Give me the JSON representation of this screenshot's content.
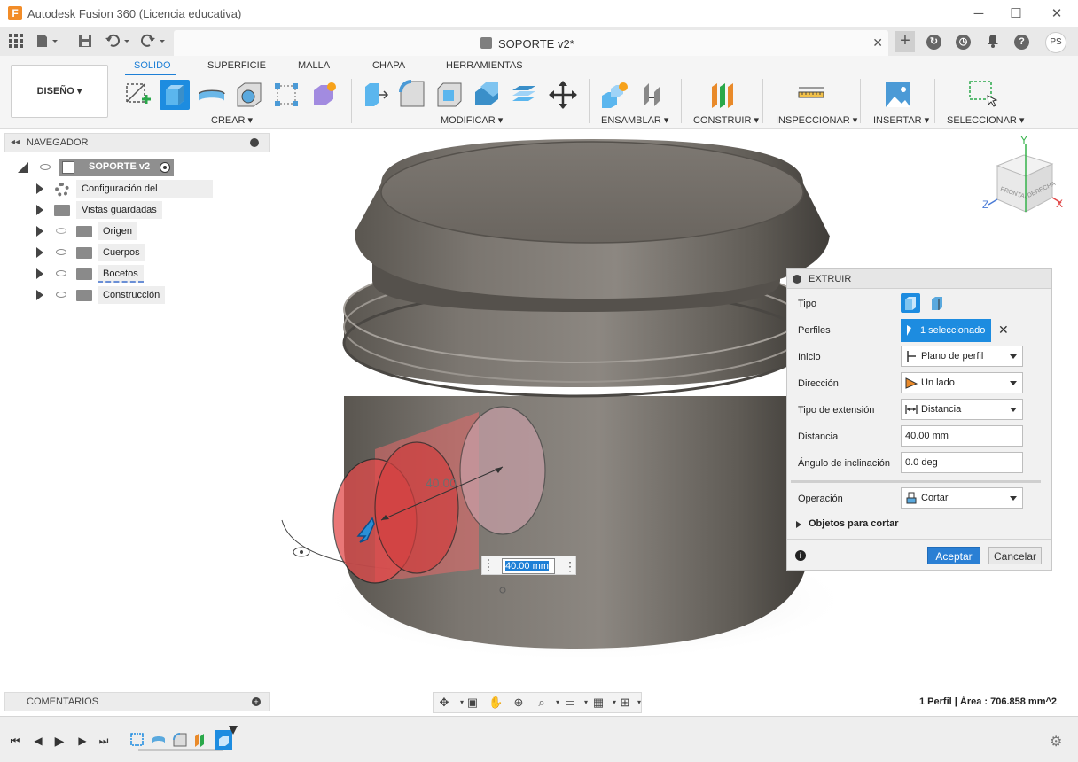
{
  "window": {
    "app_logo": "F",
    "title": "Autodesk Fusion 360 (Licencia educativa)",
    "minimize": "─",
    "maximize": "☐",
    "close": "✕"
  },
  "tabbar": {
    "document_title": "SOPORTE v2*",
    "tab_close": "✕",
    "new_tab": "+",
    "avatar": "PS"
  },
  "ribbon": {
    "workspace": "DISEÑO ▾",
    "tabs": [
      "SOLIDO",
      "SUPERFICIE",
      "MALLA",
      "CHAPA",
      "HERRAMIENTAS"
    ],
    "groups": [
      "CREAR ▾",
      "MODIFICAR ▾",
      "ENSAMBLAR ▾",
      "CONSTRUIR ▾",
      "INSPECCIONAR ▾",
      "INSERTAR ▾",
      "SELECCIONAR ▾"
    ],
    "accent": "#1d8ce0"
  },
  "navigator": {
    "title": "NAVEGADOR",
    "root": "SOPORTE v2",
    "items": [
      {
        "label": "Configuración del documento"
      },
      {
        "label": "Vistas guardadas"
      },
      {
        "label": "Origen"
      },
      {
        "label": "Cuerpos"
      },
      {
        "label": "Bocetos"
      },
      {
        "label": "Construcción"
      }
    ]
  },
  "comments": {
    "title": "COMENTARIOS"
  },
  "extrude_panel": {
    "title": "EXTRUIR",
    "rows": {
      "tipo": "Tipo",
      "perfiles": "Perfiles",
      "perfiles_value": "1 seleccionado",
      "inicio": "Inicio",
      "inicio_value": "Plano de perfil",
      "direccion": "Dirección",
      "direccion_value": "Un lado",
      "tipo_extension": "Tipo de extensión",
      "tipo_extension_value": "Distancia",
      "distancia": "Distancia",
      "distancia_value": "40.00 mm",
      "angulo": "Ángulo de inclinación",
      "angulo_value": "0.0 deg",
      "operacion": "Operación",
      "operacion_value": "Cortar",
      "objetos": "Objetos para cortar"
    },
    "clear": "✕",
    "info": "i",
    "ok": "Aceptar",
    "cancel": "Cancelar"
  },
  "viewport": {
    "dimension_label": "40.00",
    "dimension_input": "40.00 mm",
    "viewcube": {
      "front": "FRONTAL",
      "right": "DERECHA",
      "axis_x": "X",
      "axis_y": "Y",
      "axis_z": "Z"
    }
  },
  "status": {
    "text": "1 Perfil | Área : 706.858 mm^2"
  },
  "timeline": {
    "first": "⏮",
    "prev": "◀",
    "play": "▶",
    "next": "▶",
    "last": "⏭",
    "settings": "⚙"
  }
}
